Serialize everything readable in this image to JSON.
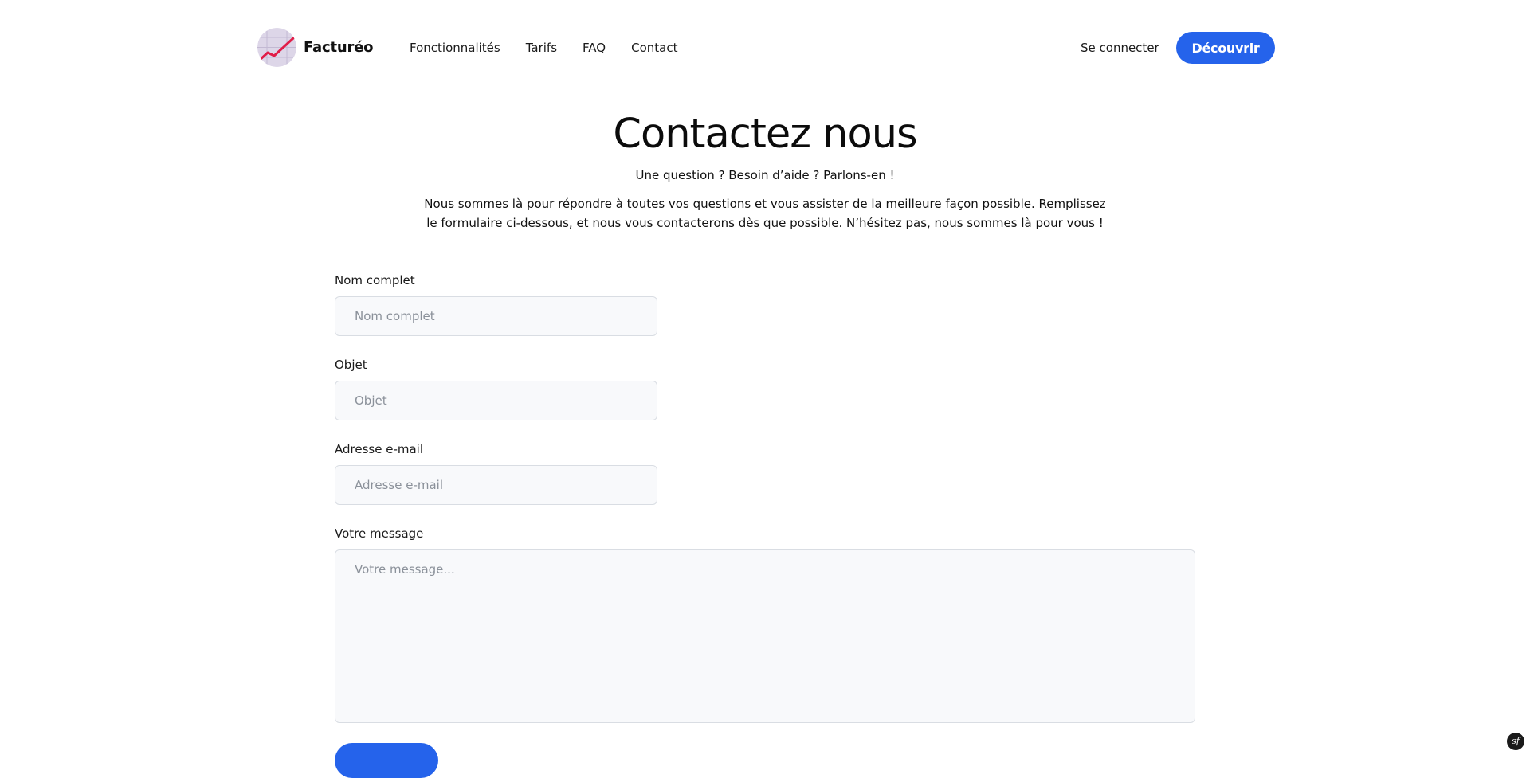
{
  "brand": {
    "name": "Facturéo",
    "logo_icon": "trend-chart-logo-icon",
    "colors": {
      "accent": "#2563eb",
      "logo_line": "#e11d48",
      "logo_bg": "#ddd6e8"
    }
  },
  "nav": {
    "items": [
      {
        "label": "Fonctionnalités"
      },
      {
        "label": "Tarifs"
      },
      {
        "label": "FAQ"
      },
      {
        "label": "Contact"
      }
    ],
    "login_label": "Se connecter",
    "cta_label": "Découvrir"
  },
  "hero": {
    "title": "Contactez nous",
    "subtitle": "Une question ? Besoin d’aide ? Parlons-en !",
    "intro": "Nous sommes là pour répondre à toutes vos questions et vous assister de la meilleure façon possible. Remplissez le formulaire ci-dessous, et nous vous contacterons dès que possible. N’hésitez pas, nous sommes là pour vous !"
  },
  "form": {
    "name": {
      "label": "Nom complet",
      "placeholder": "Nom complet",
      "value": ""
    },
    "subject": {
      "label": "Objet",
      "placeholder": "Objet",
      "value": ""
    },
    "email": {
      "label": "Adresse e-mail",
      "placeholder": "Adresse e-mail",
      "value": ""
    },
    "message": {
      "label": "Votre message",
      "placeholder": "Votre message...",
      "value": ""
    },
    "submit_label": ""
  },
  "debug_badge": {
    "label": "sf",
    "icon": "symfony-icon"
  }
}
